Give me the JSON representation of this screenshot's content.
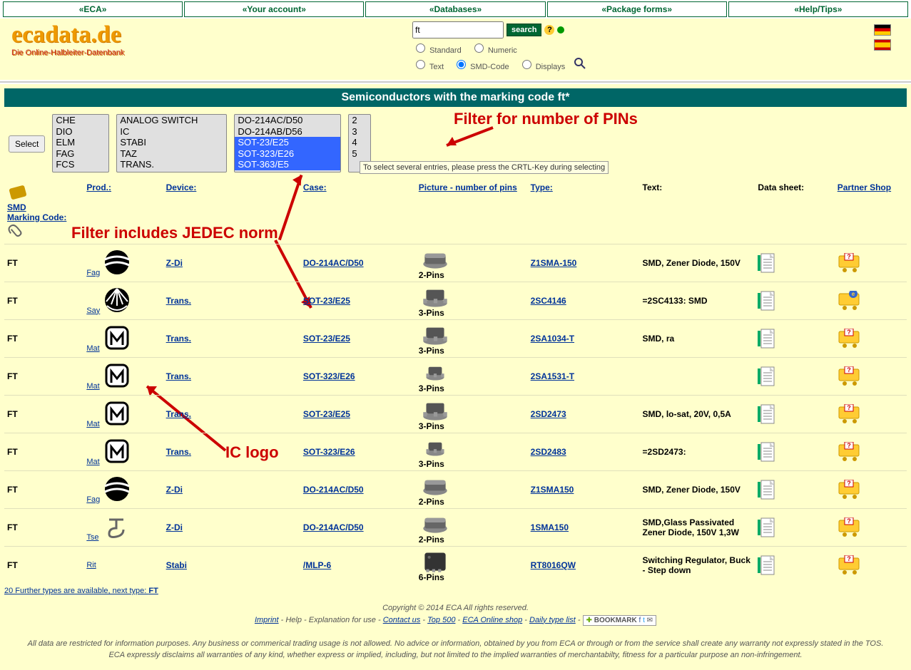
{
  "nav": {
    "items": [
      "«ECA»",
      "«Your account»",
      "«Databases»",
      "«Package forms»",
      "«Help/Tips»"
    ]
  },
  "logo": {
    "title": "ecadata.de",
    "subtitle": "Die Online-Halbleiter-Datenbank"
  },
  "search": {
    "input_value": "ft",
    "button": "search",
    "radios": {
      "standard": "Standard",
      "numeric": "Numeric",
      "text": "Text",
      "smd": "SMD-Code",
      "displays": "Displays"
    },
    "selected": "smd"
  },
  "title": "Semiconductors with the marking code ft*",
  "filters": {
    "select_button": "Select",
    "prod": [
      "CHE",
      "DIO",
      "ELM",
      "FAG",
      "FCS"
    ],
    "dev": [
      "ANALOG SWITCH",
      "IC",
      "STABI",
      "TAZ",
      "TRANS."
    ],
    "case": [
      "DO-214AC/D50",
      "DO-214AB/D56",
      "SOT-23/E25",
      "SOT-323/E26",
      "SOT-363/E5"
    ],
    "pins": [
      "2",
      "3",
      "4",
      "5"
    ],
    "tooltip": "To select several entries, please press the CRTL-Key during selecting"
  },
  "annotations": {
    "pins": "Filter for number of PINs",
    "jedec": "Filter includes JEDEC norm",
    "logo": "IC logo"
  },
  "headers": {
    "smd1": "SMD",
    "smd2": "Marking Code:",
    "prod": "Prod.:",
    "device": "Device:",
    "case": "Case:",
    "pic": "Picture - number of pins",
    "type": "Type:",
    "text": "Text:",
    "sheet": "Data sheet:",
    "shop": "Partner Shop"
  },
  "rows": [
    {
      "code": "FT",
      "prod": "Fag",
      "logo": "fag",
      "dev": "Z-Di",
      "case": "DO-214AC/D50",
      "pins": "2-Pins",
      "pkg": "d50",
      "type": "Z1SMA-150",
      "text": "SMD, Zener Diode, 150V",
      "sheet": 1,
      "cart": "q"
    },
    {
      "code": "FT",
      "prod": "Say",
      "logo": "say",
      "dev": "Trans.",
      "case": "SOT-23/E25",
      "pins": "3-Pins",
      "pkg": "sot23",
      "type": "2SC4146",
      "text": "=2SC4133: SMD",
      "sheet": 1,
      "cart": "e"
    },
    {
      "code": "FT",
      "prod": "Mat",
      "logo": "mat",
      "dev": "Trans.",
      "case": "SOT-23/E25",
      "pins": "3-Pins",
      "pkg": "sot23",
      "type": "2SA1034-T",
      "text": "SMD, ra",
      "sheet": 1,
      "cart": "q"
    },
    {
      "code": "FT",
      "prod": "Mat",
      "logo": "mat",
      "dev": "Trans.",
      "case": "SOT-323/E26",
      "pins": "3-Pins",
      "pkg": "sot323",
      "type": "2SA1531-T",
      "text": "",
      "sheet": 1,
      "cart": "q"
    },
    {
      "code": "FT",
      "prod": "Mat",
      "logo": "mat",
      "dev": "Trans.",
      "case": "SOT-23/E25",
      "pins": "3-Pins",
      "pkg": "sot23",
      "type": "2SD2473",
      "text": "SMD, lo-sat, 20V, 0,5A",
      "sheet": 1,
      "cart": "q"
    },
    {
      "code": "FT",
      "prod": "Mat",
      "logo": "mat",
      "dev": "Trans.",
      "case": "SOT-323/E26",
      "pins": "3-Pins",
      "pkg": "sot323",
      "type": "2SD2483",
      "text": "=2SD2473:",
      "sheet": 1,
      "cart": "q"
    },
    {
      "code": "FT",
      "prod": "Fag",
      "logo": "fag",
      "dev": "Z-Di",
      "case": "DO-214AC/D50",
      "pins": "2-Pins",
      "pkg": "d50",
      "type": "Z1SMA150",
      "text": "SMD, Zener Diode, 150V",
      "sheet": 1,
      "cart": "q"
    },
    {
      "code": "FT",
      "prod": "Tse",
      "logo": "tse",
      "dev": "Z-Di",
      "case": "DO-214AC/D50",
      "pins": "2-Pins",
      "pkg": "d50",
      "type": "1SMA150",
      "text": "SMD,Glass Passivated Zener Diode, 150V 1,3W",
      "sheet": 1,
      "cart": "q"
    },
    {
      "code": "FT",
      "prod": "Rit",
      "logo": "",
      "dev": "Stabi",
      "case": "/MLP-6",
      "pins": "6-Pins",
      "pkg": "mlp6",
      "type": "RT8016QW",
      "text": "Switching Regulator, Buck - Step down",
      "sheet": 1,
      "cart": "q"
    }
  ],
  "morelink": {
    "pre": "20 Further types are available, next type: ",
    "t": "FT"
  },
  "footer": {
    "copyright": "Copyright © 2014 ECA All rights reserved.",
    "links": {
      "imprint": "Imprint",
      "help": "Help - Explanation for use",
      "contact": "Contact us",
      "top500": "Top 500",
      "shop": "ECA Online shop",
      "daily": "Daily type list"
    },
    "bookmark": "BOOKMARK",
    "disclaimer": "All data are restricted for information purposes. Any business or commerical trading usage is not allowed. No advice or information, obtained by you from ECA or through or from the service shall create any warranty not expressly stated in the TOS. ECA expressly disclaims all warranties of any kind, whether express or implied, including, but not limited to the implied warranties of merchantabilty, fitness for a particular purpose an non-infringement."
  }
}
